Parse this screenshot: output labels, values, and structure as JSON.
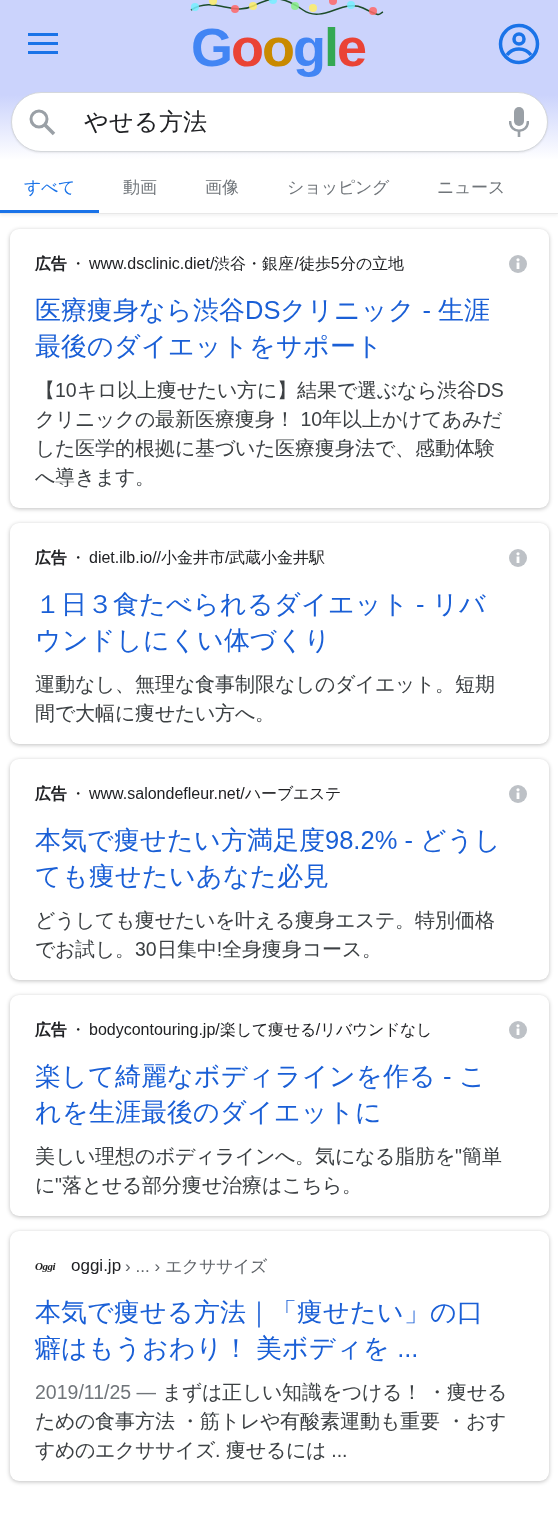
{
  "header": {
    "logo": "Google"
  },
  "search": {
    "value": "やせる方法"
  },
  "tabs": [
    {
      "label": "すべて",
      "selected": true
    },
    {
      "label": "動画",
      "selected": false
    },
    {
      "label": "画像",
      "selected": false
    },
    {
      "label": "ショッピング",
      "selected": false
    },
    {
      "label": "ニュース",
      "selected": false
    }
  ],
  "results": [
    {
      "kind": "ad",
      "ad_label": "広告",
      "separator": "・",
      "url": "www.dsclinic.diet/渋谷・銀座/徒歩5分の立地",
      "title": "医療痩身なら渋谷DSクリニック - 生涯最後のダイエットをサポート",
      "description": "【10キロ以上痩せたい方に】結果で選ぶなら渋谷DSクリニックの最新医療痩身！ 10年以上かけてあみだした医学的根拠に基づいた医療痩身法で、感動体験へ導きます。"
    },
    {
      "kind": "ad",
      "ad_label": "広告",
      "separator": "・",
      "url": "diet.ilb.io//小金井市/武蔵小金井駅",
      "title": "１日３食たべられるダイエット - リバウンドしにくい体づくり",
      "description": "運動なし、無理な食事制限なしのダイエット。短期間で大幅に痩せたい方へ。"
    },
    {
      "kind": "ad",
      "ad_label": "広告",
      "separator": "・",
      "url": "www.salondefleur.net/ハーブエステ",
      "title": "本気で痩せたい方満足度98.2% - どうしても痩せたいあなた必見",
      "description": "どうしても痩せたいを叶える痩身エステ。特別価格でお試し。30日集中!全身痩身コース。"
    },
    {
      "kind": "ad",
      "ad_label": "広告",
      "separator": "・",
      "url": "bodycontouring.jp/楽して痩せる/リバウンドなし",
      "title": "楽して綺麗なボディラインを作る - これを生涯最後のダイエットに",
      "description": "美しい理想のボディラインへ。気になる脂肪を\"簡単に\"落とせる部分痩せ治療はこちら。"
    },
    {
      "kind": "organic",
      "favicon": "Oggi",
      "site": "oggi.jp",
      "breadcrumb": "› ... › エクササイズ",
      "title": "本気で痩せる方法｜「痩せたい」の口癖はもうおわり！ 美ボディを ...",
      "date": "2019/11/25 —",
      "description": "まずは正しい知識をつける！ ・痩せるための食事方法 ・筋トレや有酸素運動も重要 ・おすすめのエクササイズ. 痩せるには ..."
    }
  ]
}
